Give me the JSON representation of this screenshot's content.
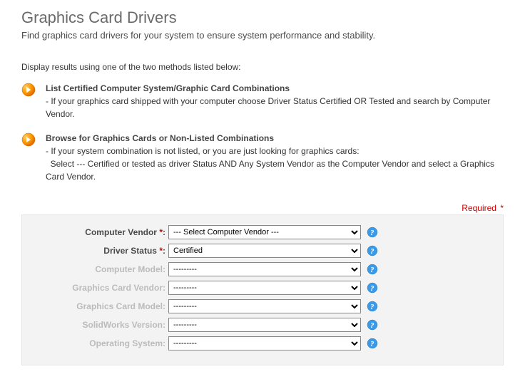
{
  "title": "Graphics Card Drivers",
  "subtitle": "Find graphics card drivers for your system to ensure system performance and stability.",
  "instruction_head": "Display results using one of the two methods listed below:",
  "methods": [
    {
      "title": "List Certified Computer System/Graphic Card Combinations",
      "desc": "- If your graphics card shipped with your computer choose Driver Status Certified OR Tested and search by Computer Vendor."
    },
    {
      "title": "Browse for Graphics Cards or Non-Listed Combinations",
      "desc": "- If your system combination is not listed, or you are just looking for graphics cards:\n  Select --- Certified or tested as driver Status AND Any System Vendor as the Computer Vendor and select a Graphics Card Vendor."
    }
  ],
  "required_label": "Required",
  "form": {
    "rows": [
      {
        "label": "Computer Vendor",
        "required": true,
        "value": "--- Select Computer Vendor ---",
        "enabled": true
      },
      {
        "label": "Driver Status",
        "required": true,
        "value": "Certified",
        "enabled": true
      },
      {
        "label": "Computer Model",
        "required": false,
        "value": "---------",
        "enabled": false
      },
      {
        "label": "Graphics Card Vendor",
        "required": false,
        "value": "---------",
        "enabled": false
      },
      {
        "label": "Graphics Card Model",
        "required": false,
        "value": "---------",
        "enabled": false
      },
      {
        "label": "SolidWorks Version",
        "required": false,
        "value": "---------",
        "enabled": false
      },
      {
        "label": "Operating System",
        "required": false,
        "value": "---------",
        "enabled": false
      }
    ]
  }
}
